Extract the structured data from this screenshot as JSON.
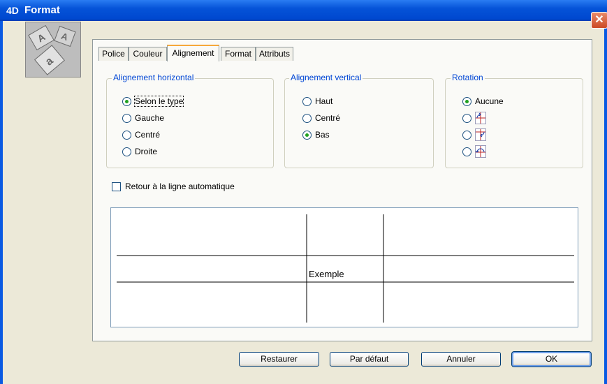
{
  "window": {
    "title": "Format",
    "logo": "4D"
  },
  "tabs": [
    "Police",
    "Couleur",
    "Alignement",
    "Format",
    "Attributs"
  ],
  "active_tab": "Alignement",
  "horizontal": {
    "label": "Alignement horizontal",
    "options": [
      "Selon le type",
      "Gauche",
      "Centré",
      "Droite"
    ],
    "selected": "Selon le type"
  },
  "vertical": {
    "label": "Alignement vertical",
    "options": [
      "Haut",
      "Centré",
      "Bas"
    ],
    "selected": "Bas"
  },
  "rotation": {
    "label": "Rotation",
    "options": [
      "Aucune"
    ],
    "icons": [
      "rotate-90-cw-icon",
      "rotate-90-ccw-icon",
      "rotate-180-icon"
    ],
    "selected": "Aucune"
  },
  "wrap": {
    "label": "Retour à la ligne automatique",
    "checked": false
  },
  "preview": {
    "text": "Exemple"
  },
  "buttons": {
    "restore": "Restaurer",
    "default": "Par défaut",
    "cancel": "Annuler",
    "ok": "OK"
  },
  "colors": {
    "titlebar": "#0553d8",
    "group_label": "#0046d5",
    "radio_dot": "#21a121",
    "active_tab_accent": "#f6a83a"
  }
}
